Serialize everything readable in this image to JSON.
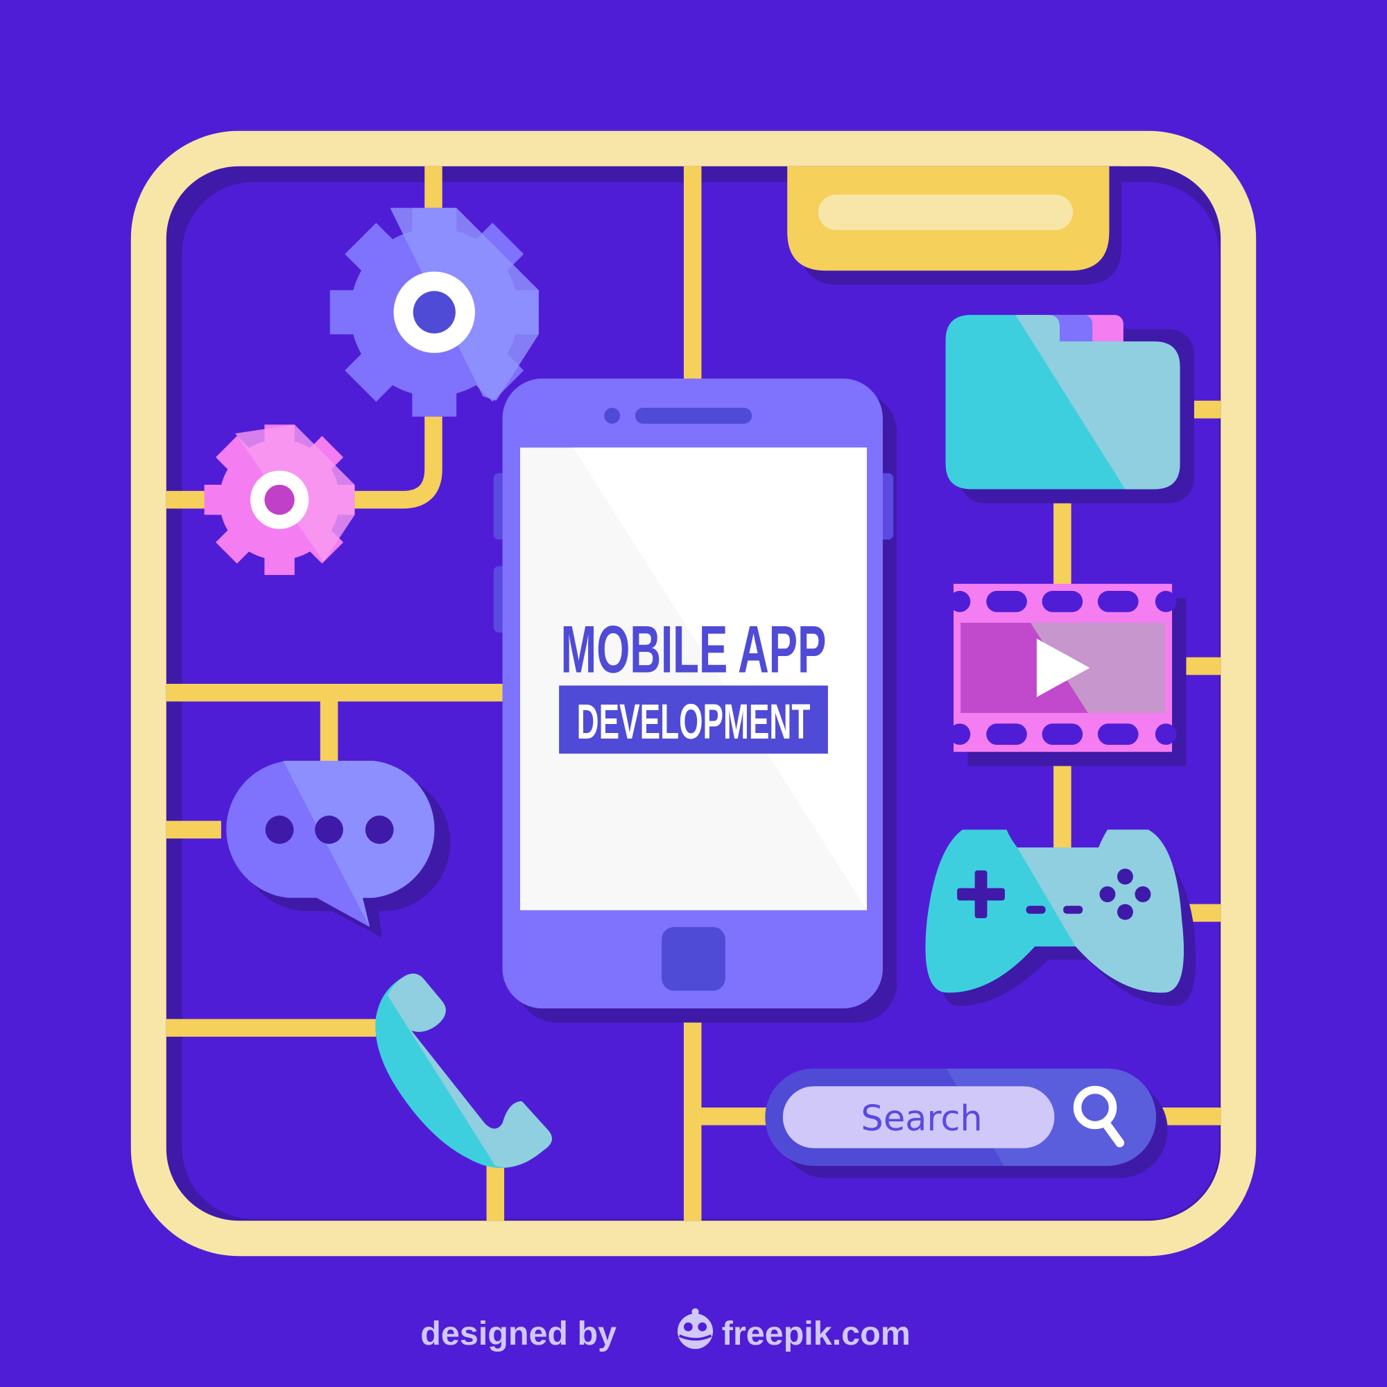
{
  "colors": {
    "background": "#501dd6",
    "frame": "#f8e6a8",
    "connector": "#f5d05a",
    "shadow": "#3f1aa8",
    "phone": "#7f72fc",
    "screen": "#f8f8f8",
    "accent_text": "#4f4bd6",
    "pink": "#f47ef1",
    "cyan": "#3ecfdf"
  },
  "phone_screen": {
    "title_line1": "MOBILE APP",
    "title_line2": "DEVELOPMENT"
  },
  "search": {
    "placeholder": "Search",
    "icon": "search-icon"
  },
  "icons": [
    "gear-icon",
    "gear-icon",
    "chat-bubble-icon",
    "phone-handset-icon",
    "folder-icon",
    "film-play-icon",
    "gamepad-icon",
    "search-icon"
  ],
  "footer": {
    "designed_by": "designed by",
    "brand": "freepik.com"
  }
}
